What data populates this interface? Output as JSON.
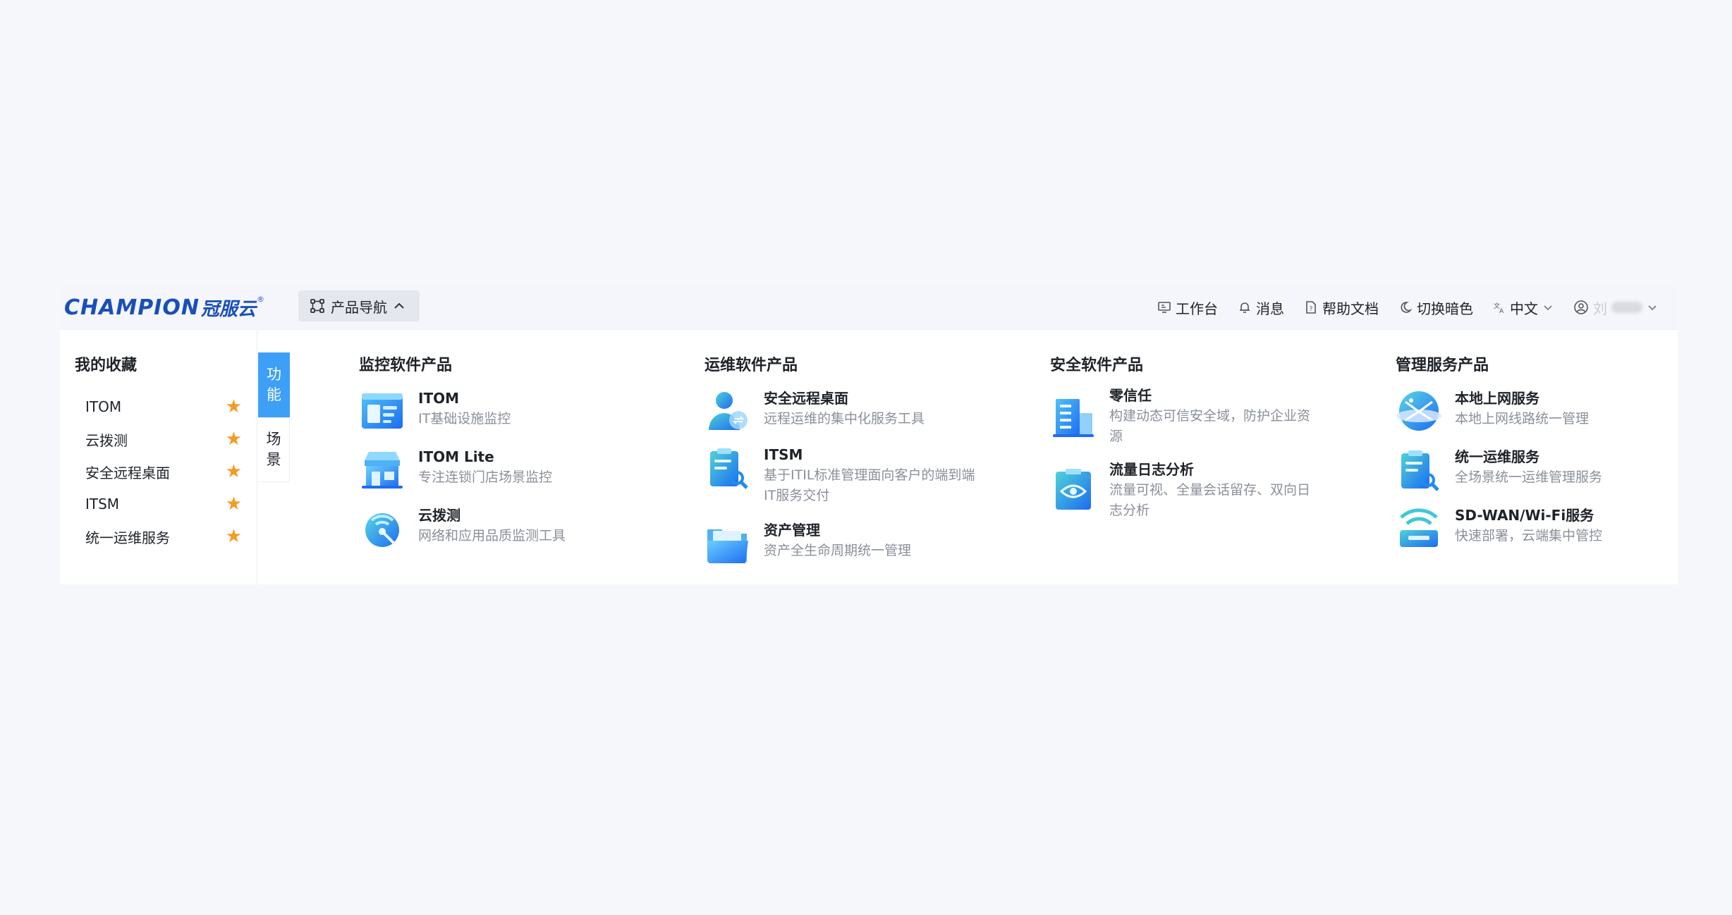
{
  "brand": {
    "logo_en": "CHAMPION",
    "logo_cn": "冠服云",
    "logo_mark": "®"
  },
  "topbar": {
    "product_nav_label": "产品导航",
    "workbench_label": "工作台",
    "messages_label": "消息",
    "help_label": "帮助文档",
    "theme_label": "切换暗色",
    "lang_label": "中文",
    "user_initial": "刘"
  },
  "favorites": {
    "title": "我的收藏",
    "items": [
      {
        "label": "ITOM"
      },
      {
        "label": "云拨测"
      },
      {
        "label": "安全远程桌面"
      },
      {
        "label": "ITSM"
      },
      {
        "label": "统一运维服务"
      }
    ]
  },
  "tabs": {
    "function_label": [
      "功",
      "能"
    ],
    "scene_label": [
      "场",
      "景"
    ]
  },
  "columns": [
    {
      "title": "监控软件产品",
      "products": [
        {
          "name": "ITOM",
          "desc": "IT基础设施监控"
        },
        {
          "name": "ITOM Lite",
          "desc": "专注连锁门店场景监控"
        },
        {
          "name": "云拨测",
          "desc": "网络和应用品质监测工具"
        }
      ]
    },
    {
      "title": "运维软件产品",
      "products": [
        {
          "name": "安全远程桌面",
          "desc": "远程运维的集中化服务工具"
        },
        {
          "name": "ITSM",
          "desc": "基于ITIL标准管理面向客户的端到端IT服务交付"
        },
        {
          "name": "资产管理",
          "desc": "资产全生命周期统一管理"
        }
      ]
    },
    {
      "title": "安全软件产品",
      "products": [
        {
          "name": "零信任",
          "desc": "构建动态可信安全域，防护企业资源"
        },
        {
          "name": "流量日志分析",
          "desc": "流量可视、全量会话留存、双向日志分析"
        }
      ]
    },
    {
      "title": "管理服务产品",
      "products": [
        {
          "name": "本地上网服务",
          "desc": "本地上网线路统一管理"
        },
        {
          "name": "统一运维服务",
          "desc": "全场景统一运维管理服务"
        },
        {
          "name": "SD-WAN/Wi-Fi服务",
          "desc": "快速部署，云端集中管控"
        }
      ]
    }
  ],
  "colors": {
    "accent": "#3e9ff7",
    "brand": "#1a4fb8",
    "star": "#f59a23",
    "muted": "#8a8f99"
  }
}
